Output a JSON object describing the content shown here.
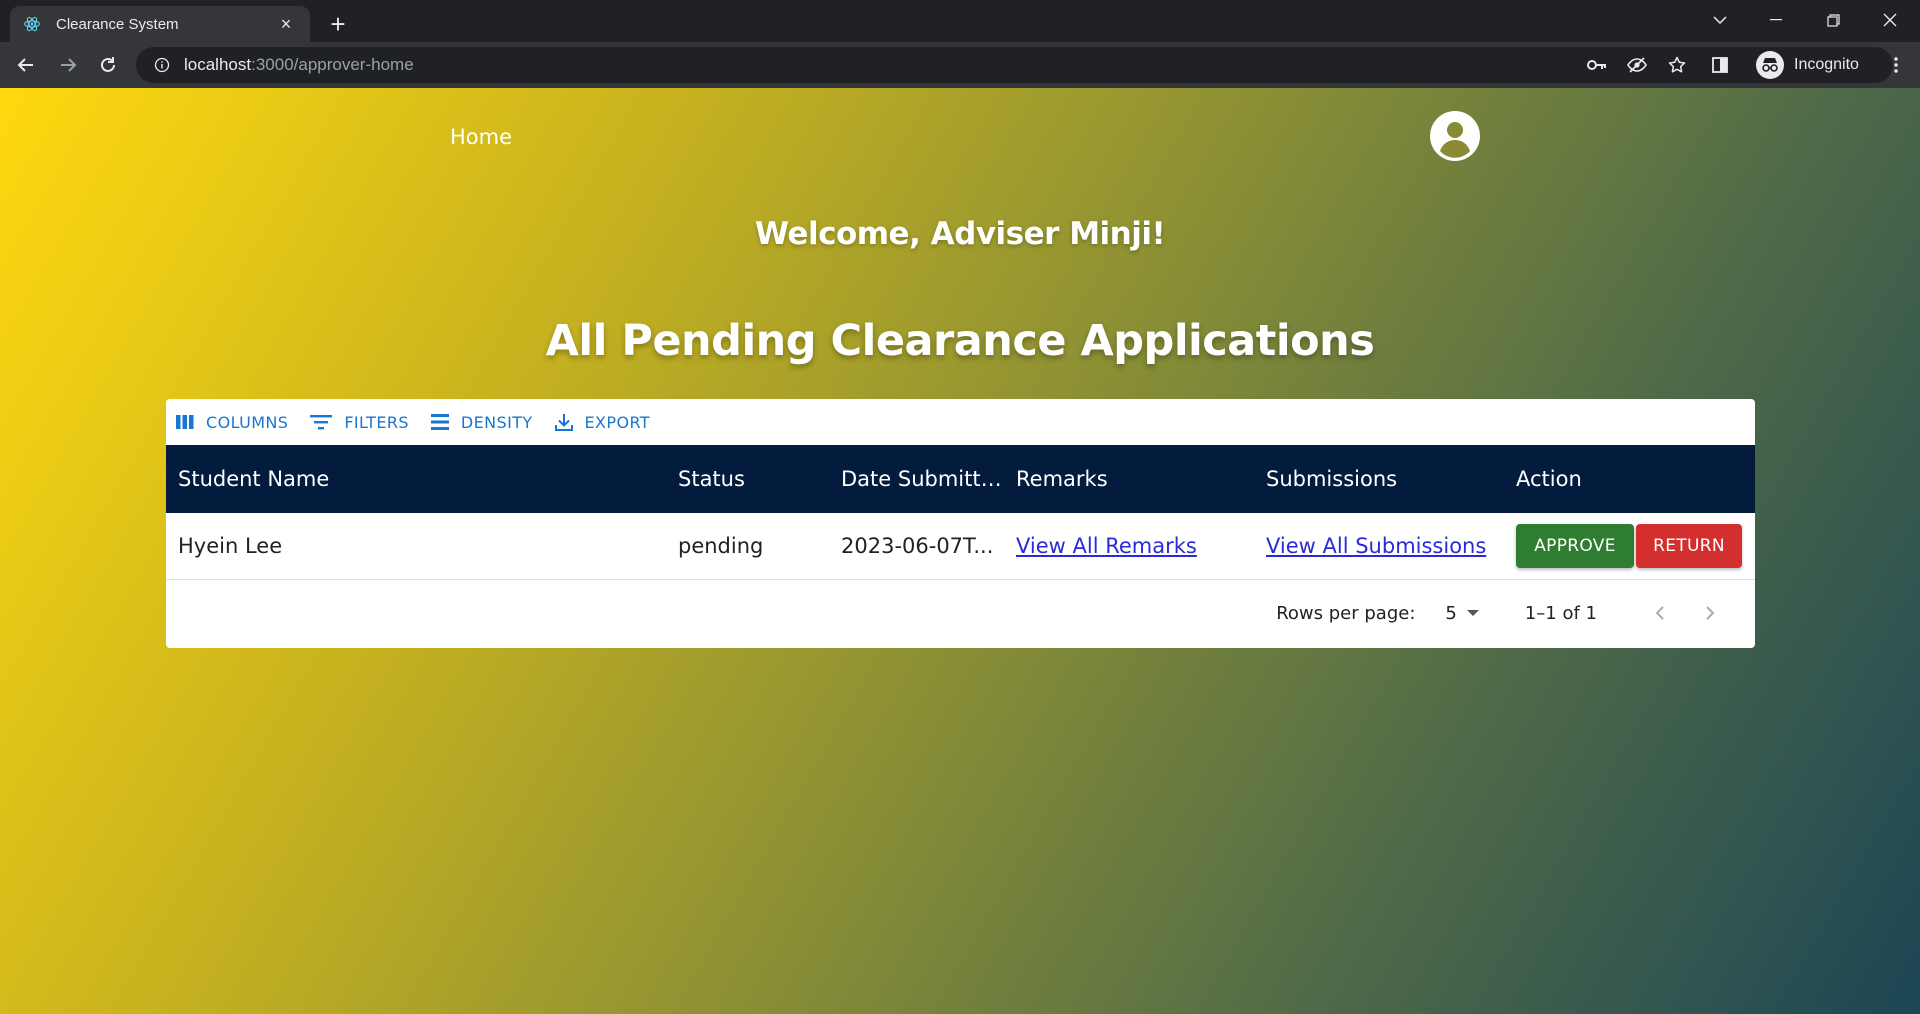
{
  "browser": {
    "tab_title": "Clearance System",
    "tab_close": "×",
    "new_tab": "+",
    "url_host": "localhost",
    "url_path": ":3000/approver-home",
    "profile_label": "Incognito"
  },
  "nav": {
    "home_label": "Home"
  },
  "page": {
    "welcome": "Welcome, Adviser Minji!",
    "heading": "All Pending Clearance Applications"
  },
  "grid": {
    "toolbar": {
      "columns": "COLUMNS",
      "filters": "FILTERS",
      "density": "DENSITY",
      "export": "EXPORT"
    },
    "headers": {
      "student_name": "Student Name",
      "status": "Status",
      "date_submitted": "Date Submitted",
      "remarks": "Remarks",
      "submissions": "Submissions",
      "action": "Action"
    },
    "rows": [
      {
        "student_name": "Hyein Lee",
        "status": "pending",
        "date_submitted": "2023-06-07T...",
        "remarks_link": "View All Remarks",
        "submissions_link": "View All Submissions",
        "approve": "APPROVE",
        "return": "RETURN"
      }
    ],
    "footer": {
      "rows_per_page_label": "Rows per page:",
      "rows_per_page_value": "5",
      "range": "1–1 of 1"
    }
  },
  "colors": {
    "accent": "#1976d2",
    "header_bg": "#031b3d",
    "approve": "#2e7d32",
    "return": "#d32f2f"
  }
}
